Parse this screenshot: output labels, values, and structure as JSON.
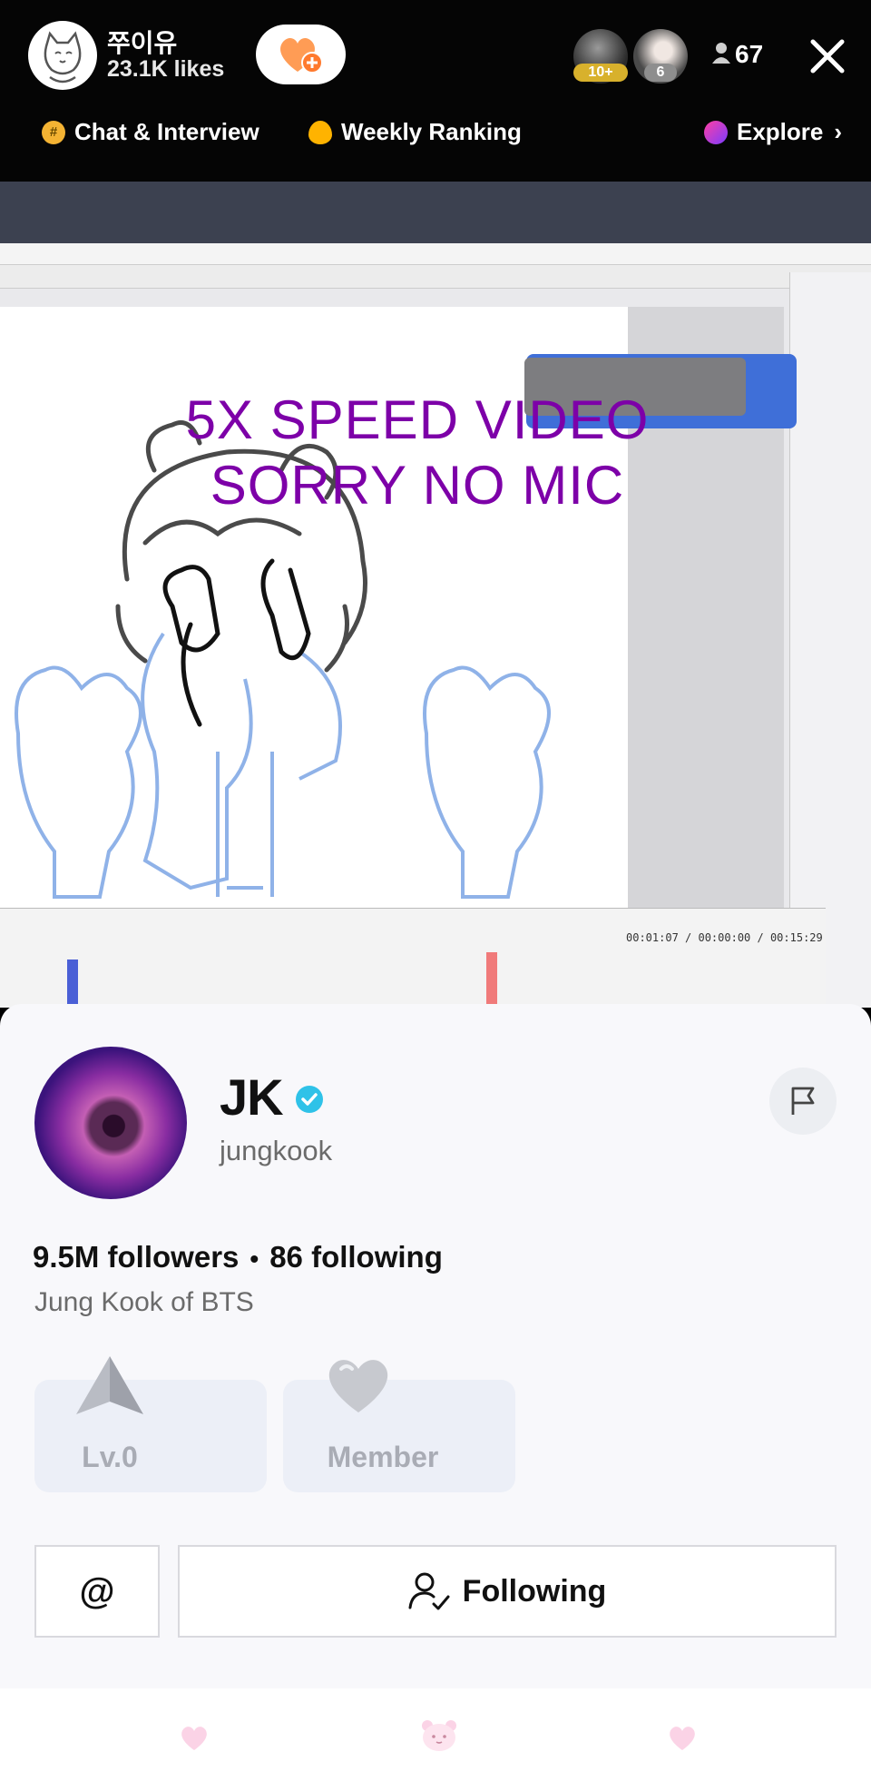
{
  "live_header": {
    "host_name": "쭈이유",
    "host_likes": "23.1K likes",
    "viewer_badges": [
      "10+",
      "6"
    ],
    "viewer_count": "67"
  },
  "chips": {
    "chat": "Chat & Interview",
    "ranking": "Weekly Ranking",
    "explore": "Explore"
  },
  "stream_overlay": {
    "line1": "5X SPEED VIDEO",
    "line2": "SORRY NO MIC",
    "timecode": "00:01:07 / 00:00:00 / 00:15:29"
  },
  "profile": {
    "name": "JK",
    "handle": "jungkook",
    "followers": "9.5M followers",
    "following": "86 following",
    "separator": "•",
    "bio": "Jung Kook of BTS",
    "level_label": "Lv.0",
    "member_label": "Member",
    "mention_label": "@",
    "follow_label": "Following"
  },
  "colors": {
    "overlay_text": "#7d00a8",
    "verified": "#2fc2e8",
    "badge_text": "#a9acb5",
    "accent_heart": "#ff8a3d"
  }
}
